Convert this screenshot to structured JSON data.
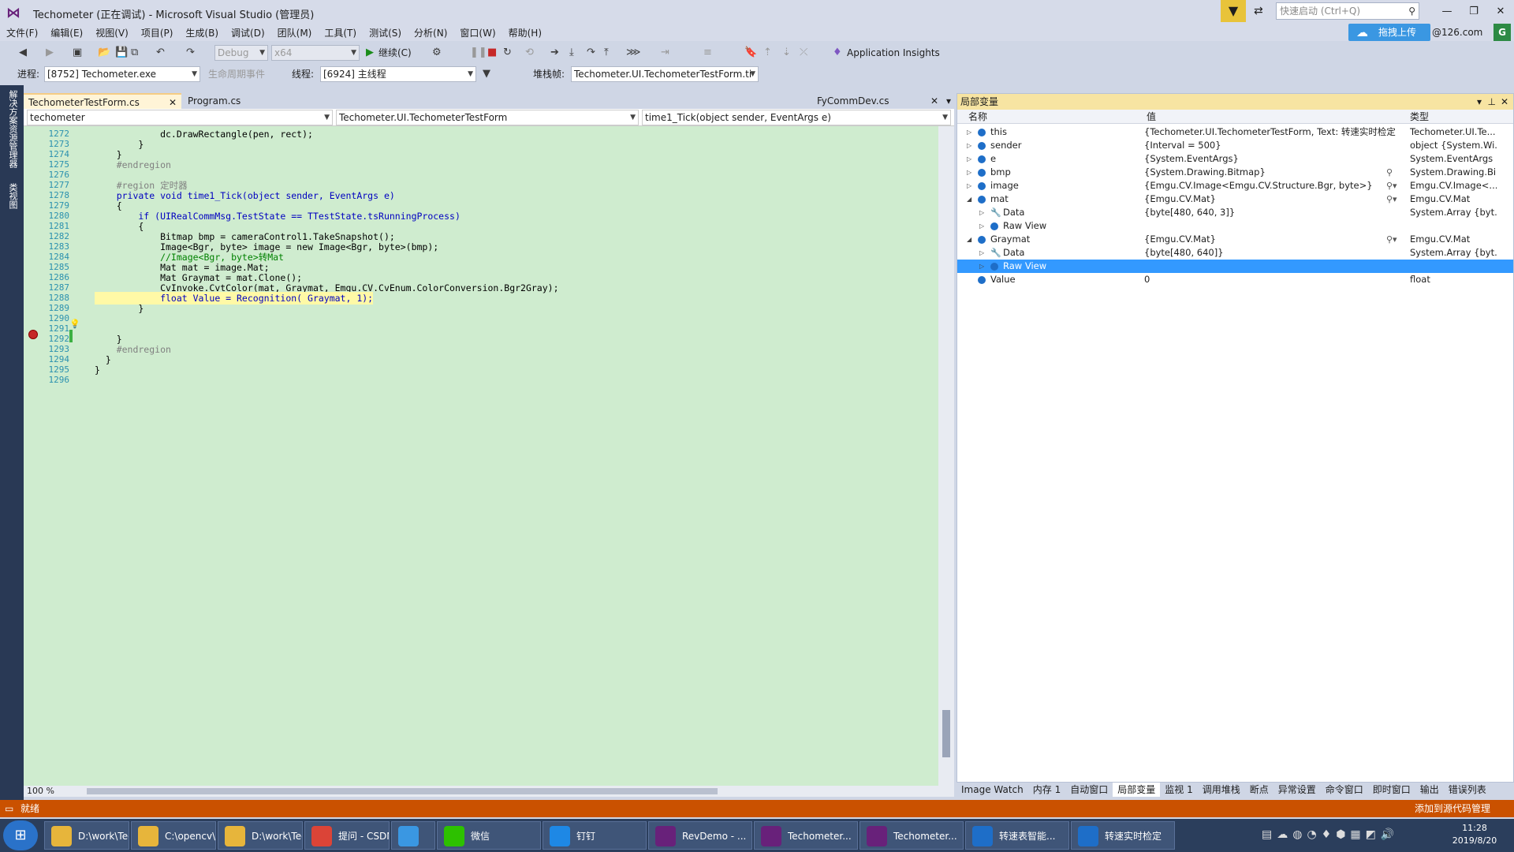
{
  "window": {
    "title": "Techometer (正在调试) - Microsoft Visual Studio (管理员)",
    "quick_launch_placeholder": "快速启动 (Ctrl+Q)",
    "upload_label": "拖拽上传",
    "account": "@126.com",
    "account_badge": "G"
  },
  "menu": [
    "文件(F)",
    "编辑(E)",
    "视图(V)",
    "项目(P)",
    "生成(B)",
    "调试(D)",
    "团队(M)",
    "工具(T)",
    "测试(S)",
    "分析(N)",
    "窗口(W)",
    "帮助(H)"
  ],
  "toolbar": {
    "config": "Debug",
    "platform": "x64",
    "continue_label": "继续(C)",
    "app_insights": "Application Insights"
  },
  "debugbar": {
    "process_label": "进程:",
    "process_value": "[8752] Techometer.exe",
    "lifecycle_label": "生命周期事件",
    "thread_label": "线程:",
    "thread_value": "[6924] 主线程",
    "stackframe_label": "堆栈帧:",
    "stackframe_value": "Techometer.UI.TechometerTestForm.ti"
  },
  "left_rail": [
    "解决方案资源管理器",
    "类视图"
  ],
  "editor": {
    "tabs": [
      "TechometerTestForm.cs",
      "Program.cs",
      "FyCommDev.cs"
    ],
    "nav_project": "techometer",
    "nav_class": "Techometer.UI.TechometerTestForm",
    "nav_member": "time1_Tick(object sender, EventArgs e)",
    "zoom": "100 %",
    "lines": [
      {
        "n": "1272",
        "t": "            dc.DrawRectangle(pen, rect);"
      },
      {
        "n": "1273",
        "t": "        }"
      },
      {
        "n": "1274",
        "t": "    }"
      },
      {
        "n": "1275",
        "t": "    #endregion"
      },
      {
        "n": "1276",
        "t": ""
      },
      {
        "n": "1277",
        "t": "    #region 定时器"
      },
      {
        "n": "1278",
        "t": "    private void time1_Tick(object sender, EventArgs e)"
      },
      {
        "n": "1279",
        "t": "    {"
      },
      {
        "n": "1280",
        "t": "        if (UIRealCommMsg.TestState == TTestState.tsRunningProcess)"
      },
      {
        "n": "1281",
        "t": "        {"
      },
      {
        "n": "1282",
        "t": "            Bitmap bmp = cameraControl1.TakeSnapshot();"
      },
      {
        "n": "1283",
        "t": "            Image<Bgr, byte> image = new Image<Bgr, byte>(bmp);"
      },
      {
        "n": "1284",
        "t": "            //Image<Bgr, byte>转Mat"
      },
      {
        "n": "1285",
        "t": "            Mat mat = image.Mat;"
      },
      {
        "n": "1286",
        "t": "            Mat Graymat = mat.Clone();"
      },
      {
        "n": "1287",
        "t": "            CvInvoke.CvtColor(mat, Graymat, Emgu.CV.CvEnum.ColorConversion.Bgr2Gray);"
      },
      {
        "n": "1288",
        "t": "            float Value = Recognition( Graymat, 1);"
      },
      {
        "n": "1289",
        "t": "        }"
      },
      {
        "n": "1290",
        "t": ""
      },
      {
        "n": "1291",
        "t": ""
      },
      {
        "n": "1292",
        "t": "    }"
      },
      {
        "n": "1293",
        "t": "    #endregion"
      },
      {
        "n": "1294",
        "t": "  }"
      },
      {
        "n": "1295",
        "t": "}"
      },
      {
        "n": "1296",
        "t": ""
      }
    ]
  },
  "locals": {
    "title": "局部变量",
    "headers": {
      "name": "名称",
      "value": "值",
      "type": "类型"
    },
    "rows": [
      {
        "name": "this",
        "value": "{Techometer.UI.TechometerTestForm, Text: 转速实时检定}",
        "type": "Techometer.UI.Te..."
      },
      {
        "name": "sender",
        "value": "{Interval = 500}",
        "type": "object {System.Wi..."
      },
      {
        "name": "e",
        "value": "{System.EventArgs}",
        "type": "System.EventArgs"
      },
      {
        "name": "bmp",
        "value": "{System.Drawing.Bitmap}",
        "type": "System.Drawing.Bi..."
      },
      {
        "name": "image",
        "value": "{Emgu.CV.Image<Emgu.CV.Structure.Bgr, byte>}",
        "type": "Emgu.CV.Image<..."
      },
      {
        "name": "mat",
        "value": "{Emgu.CV.Mat}",
        "type": "Emgu.CV.Mat"
      },
      {
        "name": "Data",
        "value": "{byte[480, 640, 3]}",
        "type": "System.Array {byt..."
      },
      {
        "name": "Raw View",
        "value": "",
        "type": ""
      },
      {
        "name": "Graymat",
        "value": "{Emgu.CV.Mat}",
        "type": "Emgu.CV.Mat"
      },
      {
        "name": "Data",
        "value": "{byte[480, 640]}",
        "type": "System.Array {byt..."
      },
      {
        "name": "Raw View",
        "value": "",
        "type": ""
      },
      {
        "name": "Value",
        "value": "0",
        "type": "float"
      }
    ],
    "bottom_tabs": [
      "Image Watch",
      "内存 1",
      "自动窗口",
      "局部变量",
      "监视 1",
      "调用堆栈",
      "断点",
      "异常设置",
      "命令窗口",
      "即时窗口",
      "输出",
      "错误列表"
    ]
  },
  "status": {
    "left": "就绪",
    "right": "添加到源代码管理"
  },
  "taskbar": {
    "items": [
      "D:\\work\\Tec...",
      "C:\\opencv\\...",
      "D:\\work\\Tec...",
      "提问 - CSDN...",
      "",
      "微信",
      "钉钉",
      "RevDemo - ...",
      "Techometer...",
      "Techometer...",
      "转速表智能...",
      "转速实时检定"
    ],
    "time": "11:28",
    "date": "2019/8/20"
  },
  "colors": {
    "accent_status": "#ca5100",
    "editor_bg": "#cfeccf",
    "selection": "#3399ff"
  }
}
